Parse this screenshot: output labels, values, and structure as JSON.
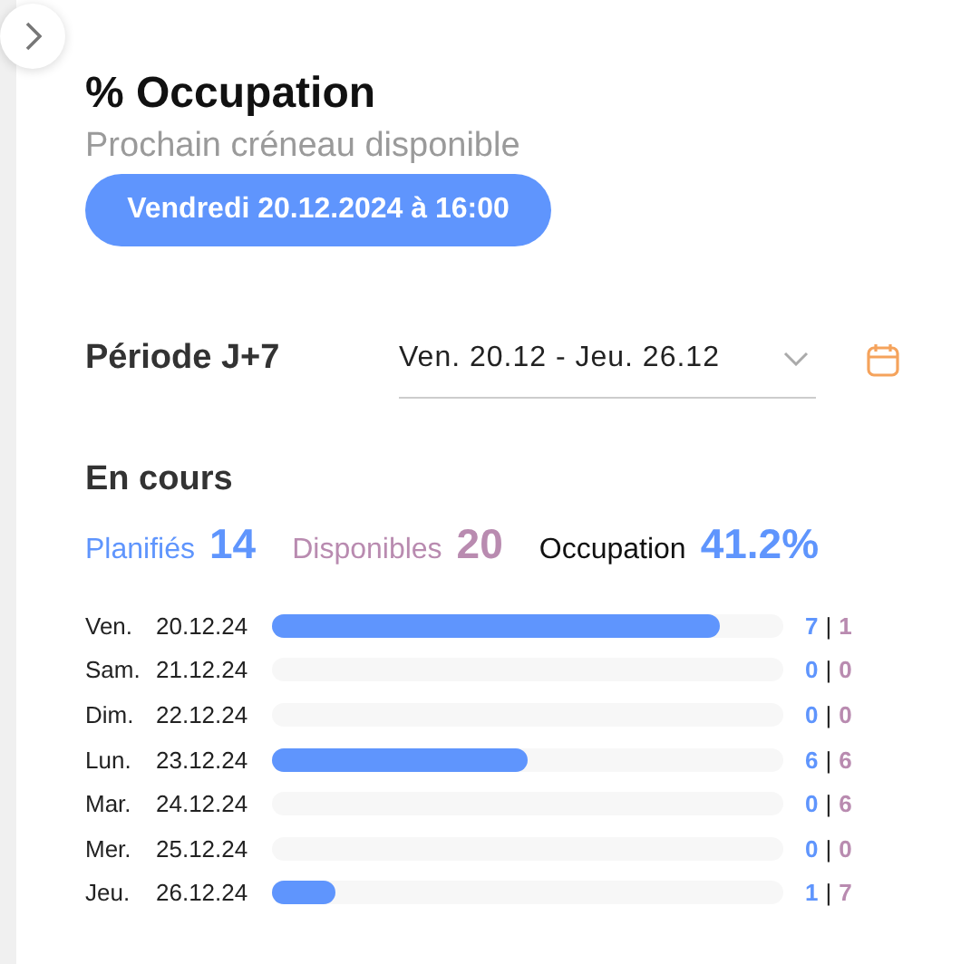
{
  "header": {
    "title": "% Occupation",
    "subtitle": "Prochain créneau disponible",
    "next_slot_button": "Vendredi 20.12.2024 à 16:00"
  },
  "period": {
    "label": "Période J+7",
    "dropdown": {
      "value": "Ven. 20.12 - Jeu. 26.12"
    }
  },
  "current": {
    "title": "En cours",
    "stats": [
      {
        "kind": "planned",
        "label": "Planifiés",
        "value": "14"
      },
      {
        "kind": "available",
        "label": "Disponibles",
        "value": "20"
      },
      {
        "kind": "occupation",
        "label": "Occupation",
        "value": "41.2%"
      }
    ]
  },
  "days": [
    {
      "day": "Ven.",
      "date": "20.12.24",
      "level": 0.875,
      "planned": "7",
      "separator": "|",
      "available": "1"
    },
    {
      "day": "Sam.",
      "date": "21.12.24",
      "planned": "0",
      "separator": "|",
      "available": "0"
    },
    {
      "day": "Dim.",
      "date": "22.12.24",
      "planned": "0",
      "separator": "|",
      "available": "0"
    },
    {
      "day": "Lun.",
      "date": "23.12.24",
      "level": 0.5,
      "planned": "6",
      "separator": "|",
      "available": "6"
    },
    {
      "day": "Mar.",
      "date": "24.12.24",
      "planned": "0",
      "separator": "|",
      "available": "6"
    },
    {
      "day": "Mer.",
      "date": "25.12.24",
      "planned": "0",
      "separator": "|",
      "available": "0"
    },
    {
      "day": "Jeu.",
      "date": "26.12.24",
      "level": 0.125,
      "planned": "1",
      "separator": "|",
      "available": "7"
    }
  ]
}
